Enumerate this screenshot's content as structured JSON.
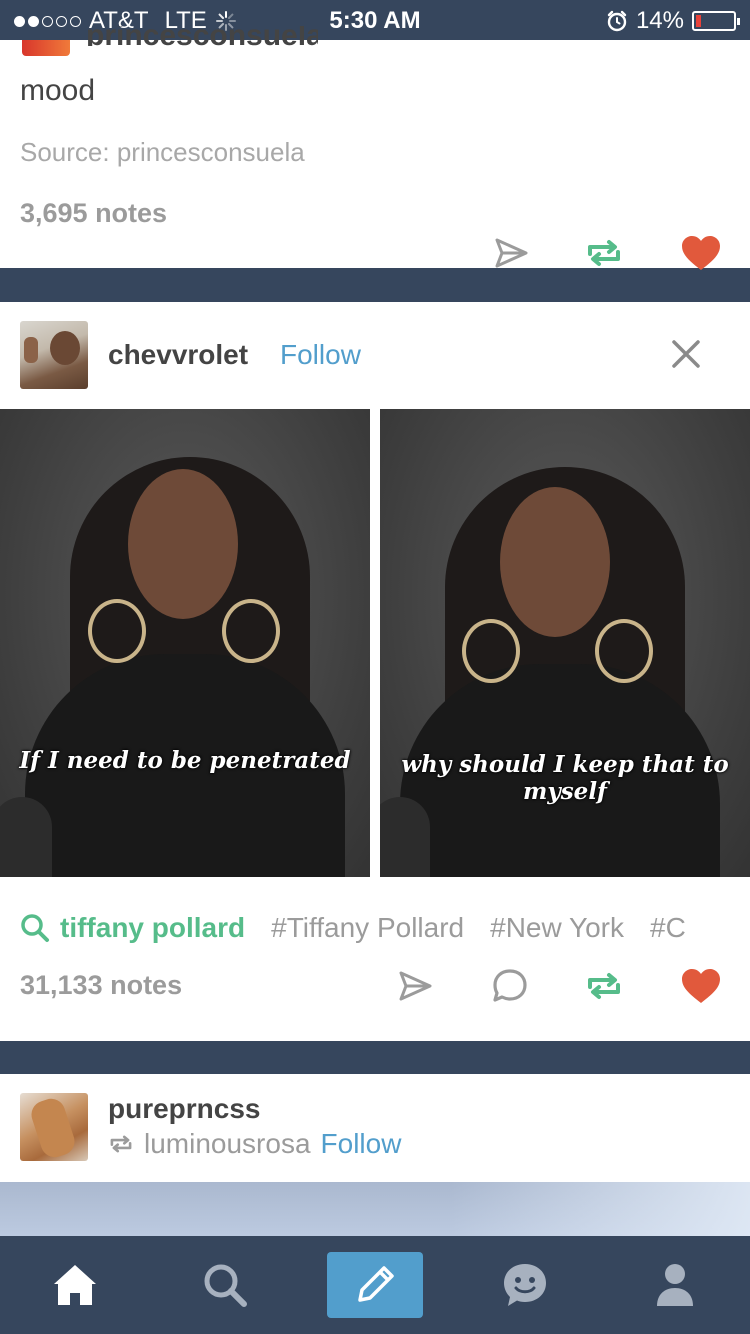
{
  "status_bar": {
    "carrier": "AT&T",
    "network": "LTE",
    "time": "5:30 AM",
    "battery": "14%",
    "battery_level": 0.14,
    "signal_bars": 2
  },
  "posts": [
    {
      "caption": "mood",
      "source": "Source: princesconsuela",
      "notes": "3,695 notes"
    },
    {
      "username": "chevvrolet",
      "follow_label": "Follow",
      "subtitles": [
        "If I need to be penetrated",
        "why should I keep that to myself"
      ],
      "search_tag": "tiffany pollard",
      "tags": [
        "#Tiffany Pollard",
        "#New York",
        "#C"
      ],
      "notes": "31,133 notes"
    },
    {
      "username": "pureprncss",
      "reblogged_from": "luminousrosa",
      "follow_label": "Follow"
    }
  ],
  "colors": {
    "navy": "#36465d",
    "blue": "#529ecc",
    "green": "#56bc8a",
    "heart": "#e1593c",
    "gray": "#9b9b9b"
  },
  "tab_bar": {
    "items": [
      "home-icon",
      "search-icon",
      "compose-icon",
      "messaging-icon",
      "account-icon"
    ],
    "active": "home"
  }
}
